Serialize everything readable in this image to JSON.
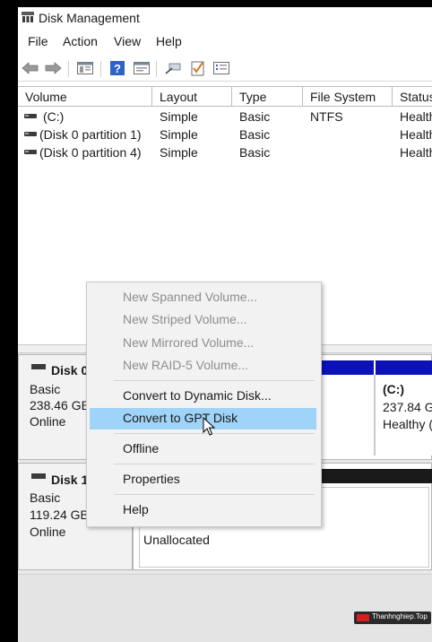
{
  "window": {
    "title": "Disk Management",
    "icon": "disk-management-icon"
  },
  "menu": [
    "File",
    "Action",
    "View",
    "Help"
  ],
  "toolbar": {
    "icons": [
      "back-arrow-icon",
      "forward-arrow-icon",
      "console-tree-icon",
      "help-icon",
      "properties-icon",
      "connect-icon",
      "check-icon",
      "list-icon"
    ]
  },
  "volume_list": {
    "columns": [
      "Volume",
      "Layout",
      "Type",
      "File System",
      "Status"
    ],
    "rows": [
      {
        "volume": "(C:)",
        "layout": "Simple",
        "type": "Basic",
        "fs": "NTFS",
        "status": "Health"
      },
      {
        "volume": "(Disk 0 partition 1)",
        "layout": "Simple",
        "type": "Basic",
        "fs": "",
        "status": "Health"
      },
      {
        "volume": "(Disk 0 partition 4)",
        "layout": "Simple",
        "type": "Basic",
        "fs": "",
        "status": "Health"
      }
    ]
  },
  "disks": [
    {
      "name": "Disk 0",
      "type": "Basic",
      "size": "238.46 GB",
      "state": "Online"
    },
    {
      "name": "Disk 1",
      "type": "Basic",
      "size": "119.24 GB",
      "state": "Online"
    }
  ],
  "partitions": {
    "disk0_c": {
      "label": "(C:)",
      "size": "237.84 G",
      "status": "Healthy ("
    },
    "disk1_unallocated": {
      "label": "Unallocated"
    }
  },
  "context_menu": {
    "items": [
      {
        "label": "New Spanned Volume...",
        "enabled": false
      },
      {
        "label": "New Striped Volume...",
        "enabled": false
      },
      {
        "label": "New Mirrored Volume...",
        "enabled": false
      },
      {
        "label": "New RAID-5 Volume...",
        "enabled": false
      },
      {
        "label": "Convert to Dynamic Disk...",
        "enabled": true
      },
      {
        "label": "Convert to GPT Disk",
        "enabled": true,
        "highlighted": true
      },
      {
        "label": "Offline",
        "enabled": true
      },
      {
        "label": "Properties",
        "enabled": true
      },
      {
        "label": "Help",
        "enabled": true
      }
    ]
  },
  "watermark": {
    "text": "Thanhnghiep.Top"
  },
  "colors": {
    "primary_partition_stripe": "#0c12b8",
    "unallocated_stripe": "#1a1a1a",
    "menu_highlight": "#9fd3f7"
  }
}
